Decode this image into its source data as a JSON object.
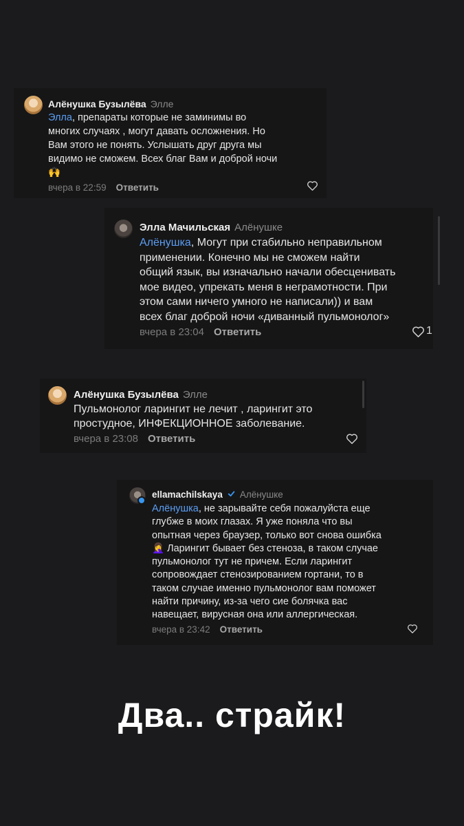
{
  "comments": [
    {
      "author": "Алёнушка Бузылёва",
      "reply_to": "Элле",
      "mention": "Элла",
      "text": ", препараты которые  не заминимы во\nмногих случаях , могут давать осложнения. Но\nВам этого  не понять. Услышать друг друга мы\nвидимо не сможем. Всех благ Вам и доброй ночи\n🙌",
      "time": "вчера в 22:59",
      "reply_label": "Ответить",
      "likes": ""
    },
    {
      "author": "Элла Мачильская",
      "reply_to": "Алёнушке",
      "mention": "Алёнушка",
      "text": ", Могут при стабильно неправильном\nприменении. Конечно мы не сможем найти\nобщий язык, вы изначально начали обесценивать\nмое видео, упрекать меня в неграмотности. При\nэтом сами ничего умного не написали)) и вам\nвсех благ доброй ночи «диванный пульмонолог»",
      "time": "вчера в 23:04",
      "reply_label": "Ответить",
      "likes": "1"
    },
    {
      "author": "Алёнушка Бузылёва",
      "reply_to": "Элле",
      "mention": "",
      "text": "Пульмонолог ларингит не лечит , ларингит это\nпростудное,  ИНФЕКЦИОННОЕ заболевание.",
      "time": "вчера в 23:08",
      "reply_label": "Ответить",
      "likes": ""
    },
    {
      "author": "ellamachilskaya",
      "reply_to": "Алёнушке",
      "mention": "Алёнушка",
      "text": ", не зарывайте себя пожалуйста еще\nглубже в моих глазах. Я уже поняла что вы\nопытная через браузер, только вот снова ошибка\n🤦‍♀️ Ларингит бывает без стеноза, в таком случае\nпульмонолог тут не причем. Если ларингит\nсопровождает стенозированием гортани, то в\nтаком случае именно пульмонолог вам поможет\nнайти причину, из-за чего сие болячка вас\nнавещает, вирусная она или аллергическая.",
      "time": "вчера в 23:42",
      "reply_label": "Ответить",
      "likes": ""
    }
  ],
  "headline": "Два.. страйк!",
  "colors": {
    "background": "#1b1b1d",
    "mention": "#5b9ef3",
    "verified": "#3897f0"
  },
  "icons": [
    "heart-icon",
    "verified-badge-icon"
  ]
}
